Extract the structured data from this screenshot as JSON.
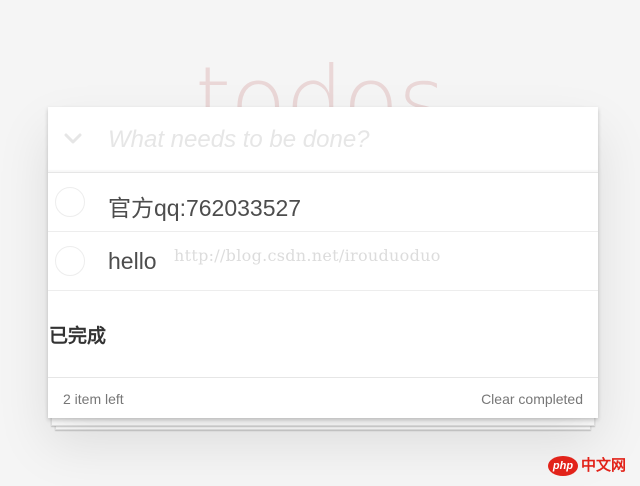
{
  "header": {
    "title": "todos"
  },
  "new_todo": {
    "placeholder": "What needs to be done?",
    "value": ""
  },
  "todos": [
    {
      "label": "官方qq:762033527",
      "completed": false
    },
    {
      "label": "hello",
      "completed": false
    }
  ],
  "watermark": "http://blog.csdn.net/irouduoduo",
  "completed_section": {
    "heading": "已完成"
  },
  "footer": {
    "count_text": "2 item left",
    "clear_label": "Clear completed"
  },
  "badge": {
    "logo_text": "php",
    "site_text": "中文网",
    "brand_color": "#e2231a"
  },
  "colors": {
    "title": "#eadada",
    "text": "#4d4d4d",
    "footer_text": "#777777",
    "background": "#f5f5f5"
  }
}
